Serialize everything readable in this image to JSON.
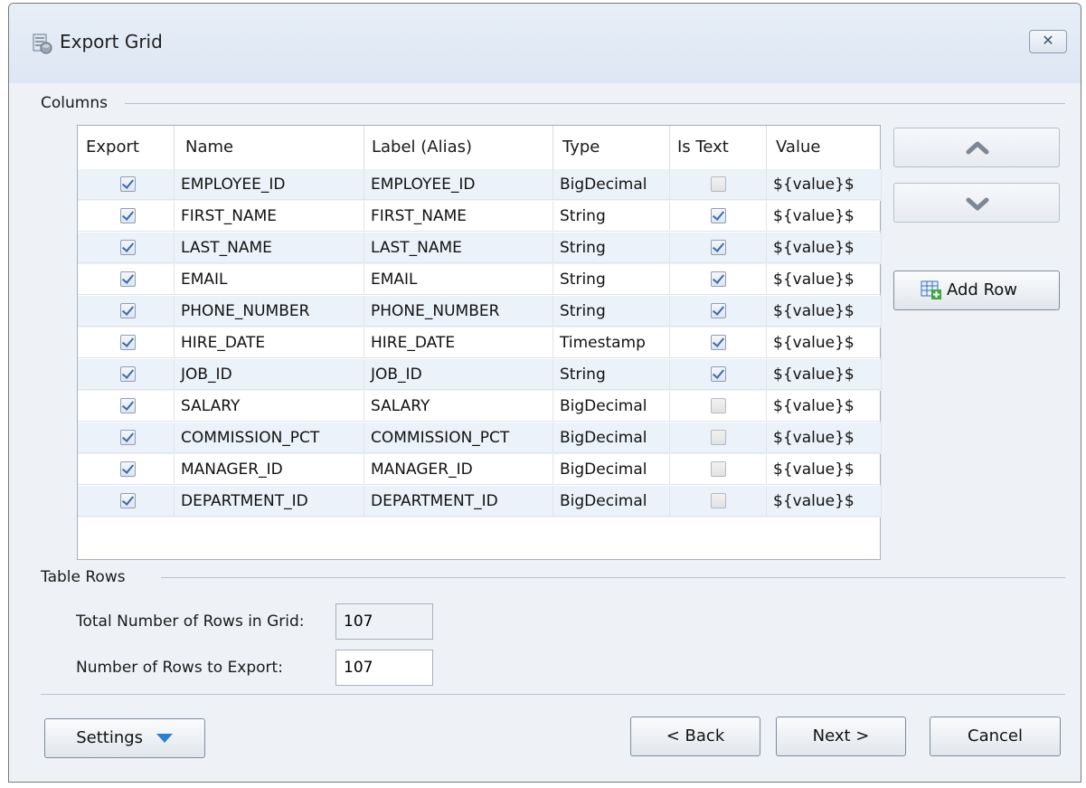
{
  "window": {
    "title": "Export Grid"
  },
  "columns_section": {
    "label": "Columns"
  },
  "grid": {
    "headers": [
      "Export",
      "Name",
      "Label (Alias)",
      "Type",
      "Is Text",
      "Value"
    ],
    "rows": [
      {
        "export": true,
        "name": "EMPLOYEE_ID",
        "label": "EMPLOYEE_ID",
        "type": "BigDecimal",
        "is_text": false,
        "value": "${value}$"
      },
      {
        "export": true,
        "name": "FIRST_NAME",
        "label": "FIRST_NAME",
        "type": "String",
        "is_text": true,
        "value": "${value}$"
      },
      {
        "export": true,
        "name": "LAST_NAME",
        "label": "LAST_NAME",
        "type": "String",
        "is_text": true,
        "value": "${value}$"
      },
      {
        "export": true,
        "name": "EMAIL",
        "label": "EMAIL",
        "type": "String",
        "is_text": true,
        "value": "${value}$"
      },
      {
        "export": true,
        "name": "PHONE_NUMBER",
        "label": "PHONE_NUMBER",
        "type": "String",
        "is_text": true,
        "value": "${value}$"
      },
      {
        "export": true,
        "name": "HIRE_DATE",
        "label": "HIRE_DATE",
        "type": "Timestamp",
        "is_text": true,
        "value": "${value}$"
      },
      {
        "export": true,
        "name": "JOB_ID",
        "label": "JOB_ID",
        "type": "String",
        "is_text": true,
        "value": "${value}$"
      },
      {
        "export": true,
        "name": "SALARY",
        "label": "SALARY",
        "type": "BigDecimal",
        "is_text": false,
        "value": "${value}$"
      },
      {
        "export": true,
        "name": "COMMISSION_PCT",
        "label": "COMMISSION_PCT",
        "type": "BigDecimal",
        "is_text": false,
        "value": "${value}$"
      },
      {
        "export": true,
        "name": "MANAGER_ID",
        "label": "MANAGER_ID",
        "type": "BigDecimal",
        "is_text": false,
        "value": "${value}$"
      },
      {
        "export": true,
        "name": "DEPARTMENT_ID",
        "label": "DEPARTMENT_ID",
        "type": "BigDecimal",
        "is_text": false,
        "value": "${value}$"
      }
    ]
  },
  "side_buttons": {
    "up_icon": "chevron-up-icon",
    "down_icon": "chevron-down-icon",
    "add_row_label": "Add Row",
    "add_row_icon": "add-row-icon"
  },
  "table_rows_section": {
    "label": "Table Rows",
    "total_label": "Total Number of Rows in Grid:",
    "total_value": "107",
    "export_label": "Number of Rows to Export:",
    "export_value": "107"
  },
  "footer": {
    "settings_label": "Settings",
    "back_label": "< Back",
    "next_label": "Next >",
    "cancel_label": "Cancel"
  },
  "colors": {
    "accent": "#3d6aa8",
    "dropdown_arrow": "#2a7fd4"
  }
}
